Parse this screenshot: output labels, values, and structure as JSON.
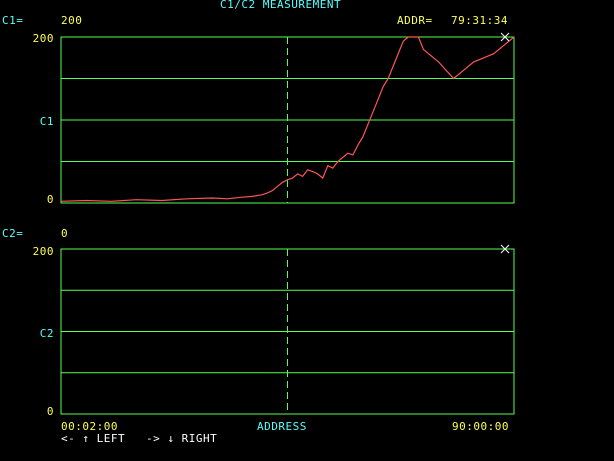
{
  "title": "C1/C2 MEASUREMENT",
  "c1_readout": {
    "label": "C1=",
    "value": "200"
  },
  "addr_readout": {
    "label": "ADDR=",
    "value": "79:31:34"
  },
  "c2_readout": {
    "label": "C2=",
    "value": "0"
  },
  "panel1": {
    "ymax": "200",
    "ylabel": "C1",
    "ymin": "0"
  },
  "panel2": {
    "ymax": "200",
    "ylabel": "C2",
    "ymin": "0"
  },
  "x_axis": {
    "start": "00:02:00",
    "label": "ADDRESS",
    "end": "90:00:00"
  },
  "nav": {
    "left": "<- ↑ LEFT",
    "right": "-> ↓ RIGHT"
  },
  "colors": {
    "grid": "#55ff55",
    "trace": "#ff5555",
    "label": "#55ffff",
    "value": "#ffff55",
    "marker": "#ffffff"
  },
  "chart_data": [
    {
      "type": "line",
      "ylabel": "C1",
      "ylim": [
        0,
        200
      ],
      "grid": true,
      "series": [
        {
          "x": [
            0,
            5,
            10,
            15,
            20,
            25,
            30,
            33,
            36,
            38,
            40,
            41,
            42,
            43,
            44,
            45,
            46,
            47,
            48,
            49,
            50,
            51,
            52,
            53,
            54,
            55,
            56,
            57,
            58,
            59,
            60,
            61,
            62,
            63,
            64,
            65,
            66,
            67,
            68,
            69,
            70,
            71,
            72,
            75,
            78,
            80,
            82,
            84,
            86,
            88,
            89,
            90
          ],
          "y": [
            2,
            3,
            2,
            4,
            3,
            5,
            6,
            5,
            7,
            8,
            10,
            12,
            15,
            20,
            25,
            28,
            30,
            35,
            32,
            40,
            38,
            35,
            30,
            45,
            42,
            50,
            55,
            60,
            58,
            70,
            80,
            95,
            110,
            125,
            140,
            150,
            165,
            180,
            195,
            200,
            200,
            200,
            185,
            170,
            150,
            160,
            170,
            175,
            180,
            190,
            195,
            200
          ]
        }
      ]
    },
    {
      "type": "line",
      "ylabel": "C2",
      "ylim": [
        0,
        200
      ],
      "grid": true,
      "series": []
    }
  ]
}
